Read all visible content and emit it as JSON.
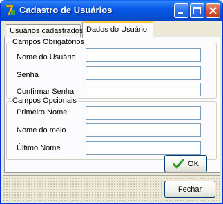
{
  "window": {
    "title": "Cadastro de Usuários",
    "icon": "delphi-app-icon"
  },
  "titlebar_buttons": [
    "minimize",
    "maximize",
    "close"
  ],
  "tabs": [
    {
      "label": "Usuários cadastrados",
      "active": false
    },
    {
      "label": "Dados do Usuário",
      "active": true
    }
  ],
  "groups": {
    "required": {
      "caption": "Campos Obrigatórios",
      "fields": [
        {
          "label": "Nome do Usuário",
          "value": ""
        },
        {
          "label": "Senha",
          "value": ""
        },
        {
          "label": "Confirmar Senha",
          "value": ""
        }
      ]
    },
    "optional": {
      "caption": "Campos Opcionais",
      "fields": [
        {
          "label": "Primeiro Nome",
          "value": ""
        },
        {
          "label": "Nome do meio",
          "value": ""
        },
        {
          "label": "Último Nome",
          "value": ""
        }
      ]
    }
  },
  "buttons": {
    "ok_label": "OK",
    "close_label": "Fechar"
  },
  "colors": {
    "titlebar": "#0552d8",
    "ok_check": "#2a9a2a"
  }
}
